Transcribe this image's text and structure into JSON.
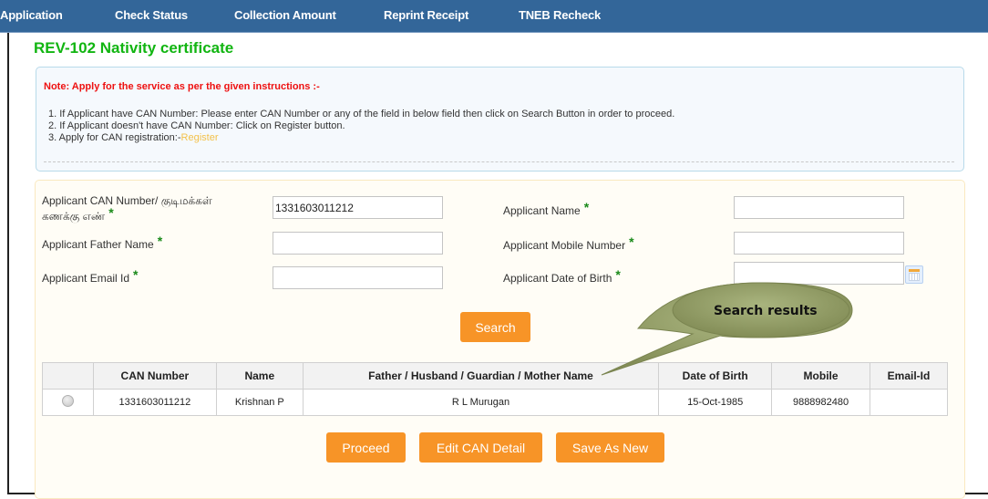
{
  "nav": {
    "items": [
      {
        "label": "Application"
      },
      {
        "label": "Check Status"
      },
      {
        "label": "Collection Amount"
      },
      {
        "label": "Reprint Receipt"
      },
      {
        "label": "TNEB Recheck"
      }
    ]
  },
  "page": {
    "title": "REV-102 Nativity certificate"
  },
  "note": {
    "title": "Note: Apply for the service as per the given instructions :-",
    "lines": [
      "1. If Applicant have CAN Number: Please enter CAN Number or any of the field in below field then click on Search Button in order to proceed.",
      "2. If Applicant doesn't have CAN Number: Click on Register button.",
      "3. Apply for CAN registration:-"
    ],
    "register_link": "Register"
  },
  "form": {
    "can_number": {
      "label_line1": "Applicant CAN Number/ குடிமக்கள்",
      "label_line2": "கணக்கு எண்",
      "value": "1331603011212"
    },
    "applicant_name": {
      "label": "Applicant Name",
      "value": ""
    },
    "father_name": {
      "label": "Applicant Father Name",
      "value": ""
    },
    "mobile": {
      "label": "Applicant Mobile Number",
      "value": ""
    },
    "email": {
      "label": "Applicant Email Id",
      "value": ""
    },
    "dob": {
      "label": "Applicant Date of Birth",
      "value": ""
    },
    "required_marker": "*",
    "search_button": "Search"
  },
  "results": {
    "columns": [
      "",
      "CAN Number",
      "Name",
      "Father / Husband / Guardian / Mother Name",
      "Date of Birth",
      "Mobile",
      "Email-Id"
    ],
    "rows": [
      {
        "can_number": "1331603011212",
        "name": "Krishnan P",
        "guardian": "R L Murugan",
        "dob": "15-Oct-1985",
        "mobile": "9888982480",
        "email": ""
      }
    ]
  },
  "actions": {
    "proceed": "Proceed",
    "edit": "Edit CAN Detail",
    "save_new": "Save As New"
  },
  "callout": {
    "text": "Search results"
  },
  "colors": {
    "nav_bg": "#336699",
    "title_green": "#11b511",
    "note_red": "#ee1111",
    "link_yellow": "#f3c14a",
    "button_orange": "#f79427",
    "callout_olive": "#9aa56e"
  }
}
